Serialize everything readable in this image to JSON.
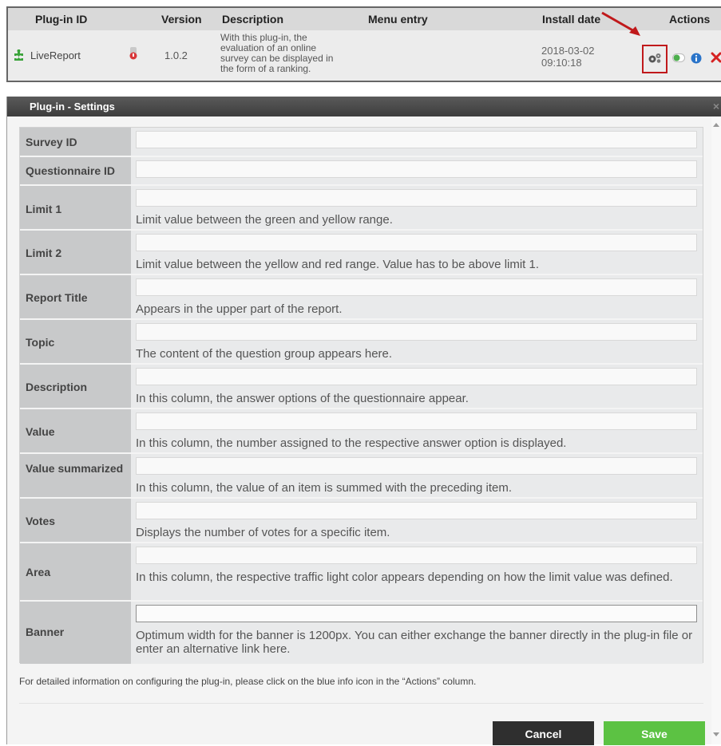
{
  "plugin_table": {
    "headers": {
      "plugin_id": "Plug-in ID",
      "version": "Version",
      "description": "Description",
      "menu_entry": "Menu entry",
      "install_date": "Install date",
      "actions": "Actions"
    },
    "row": {
      "name": "LiveReport",
      "version": "1.0.2",
      "description_lines": [
        "With this plug-in, the",
        "evaluation of an online",
        "survey can be displayed in",
        "the form of a ranking."
      ],
      "install_date": "2018-03-02",
      "install_time": "09:10:18",
      "icons": {
        "plugin": "puzzle-icon",
        "status": "status-icon",
        "settings": "gears-icon",
        "toggle": "toggle-icon",
        "info": "info-icon",
        "delete": "delete-icon"
      }
    }
  },
  "dialog": {
    "title": "Plug-in - Settings",
    "fields": [
      {
        "label": "Survey ID",
        "value": "",
        "hint": ""
      },
      {
        "label": "Questionnaire ID",
        "value": "",
        "hint": ""
      },
      {
        "label": "Limit 1",
        "value": "",
        "hint": "Limit value between the green and yellow range."
      },
      {
        "label": "Limit 2",
        "value": "",
        "hint": "Limit value between the yellow and red range. Value has to be above limit 1."
      },
      {
        "label": "Report Title",
        "value": "",
        "hint": "Appears in the upper part of the report."
      },
      {
        "label": "Topic",
        "value": "",
        "hint": "The content of the question group appears here."
      },
      {
        "label": "Description",
        "value": "",
        "hint": "In this column, the answer options of the questionnaire appear."
      },
      {
        "label": "Value",
        "value": "",
        "hint": "In this column, the number assigned to the respective answer option is displayed."
      },
      {
        "label": "Value summarized",
        "value": "",
        "hint": "In this column, the value of an item is summed with the preceding item."
      },
      {
        "label": "Votes",
        "value": "",
        "hint": "Displays the number of votes for a specific item."
      },
      {
        "label": "Area",
        "value": "",
        "hint": "In this column, the respective traffic light color appears depending on how the limit value was defined."
      },
      {
        "label": "Banner",
        "value": "",
        "hint": "Optimum width for the banner is 1200px. You can either exchange the banner directly in the plug-in file or enter an alternative link here."
      }
    ],
    "footer_note": "For detailed information on configuring the plug-in, please click on the blue info icon in the “Actions” column.",
    "cancel_label": "Cancel",
    "save_label": "Save"
  },
  "colors": {
    "highlight_box": "#c0191b",
    "save_button": "#5cc243",
    "cancel_button": "#2f2f2f",
    "titlebar": "#474747",
    "info_blue": "#2a74c9",
    "delete_red": "#d62222",
    "toggle_green": "#4cae4c"
  }
}
